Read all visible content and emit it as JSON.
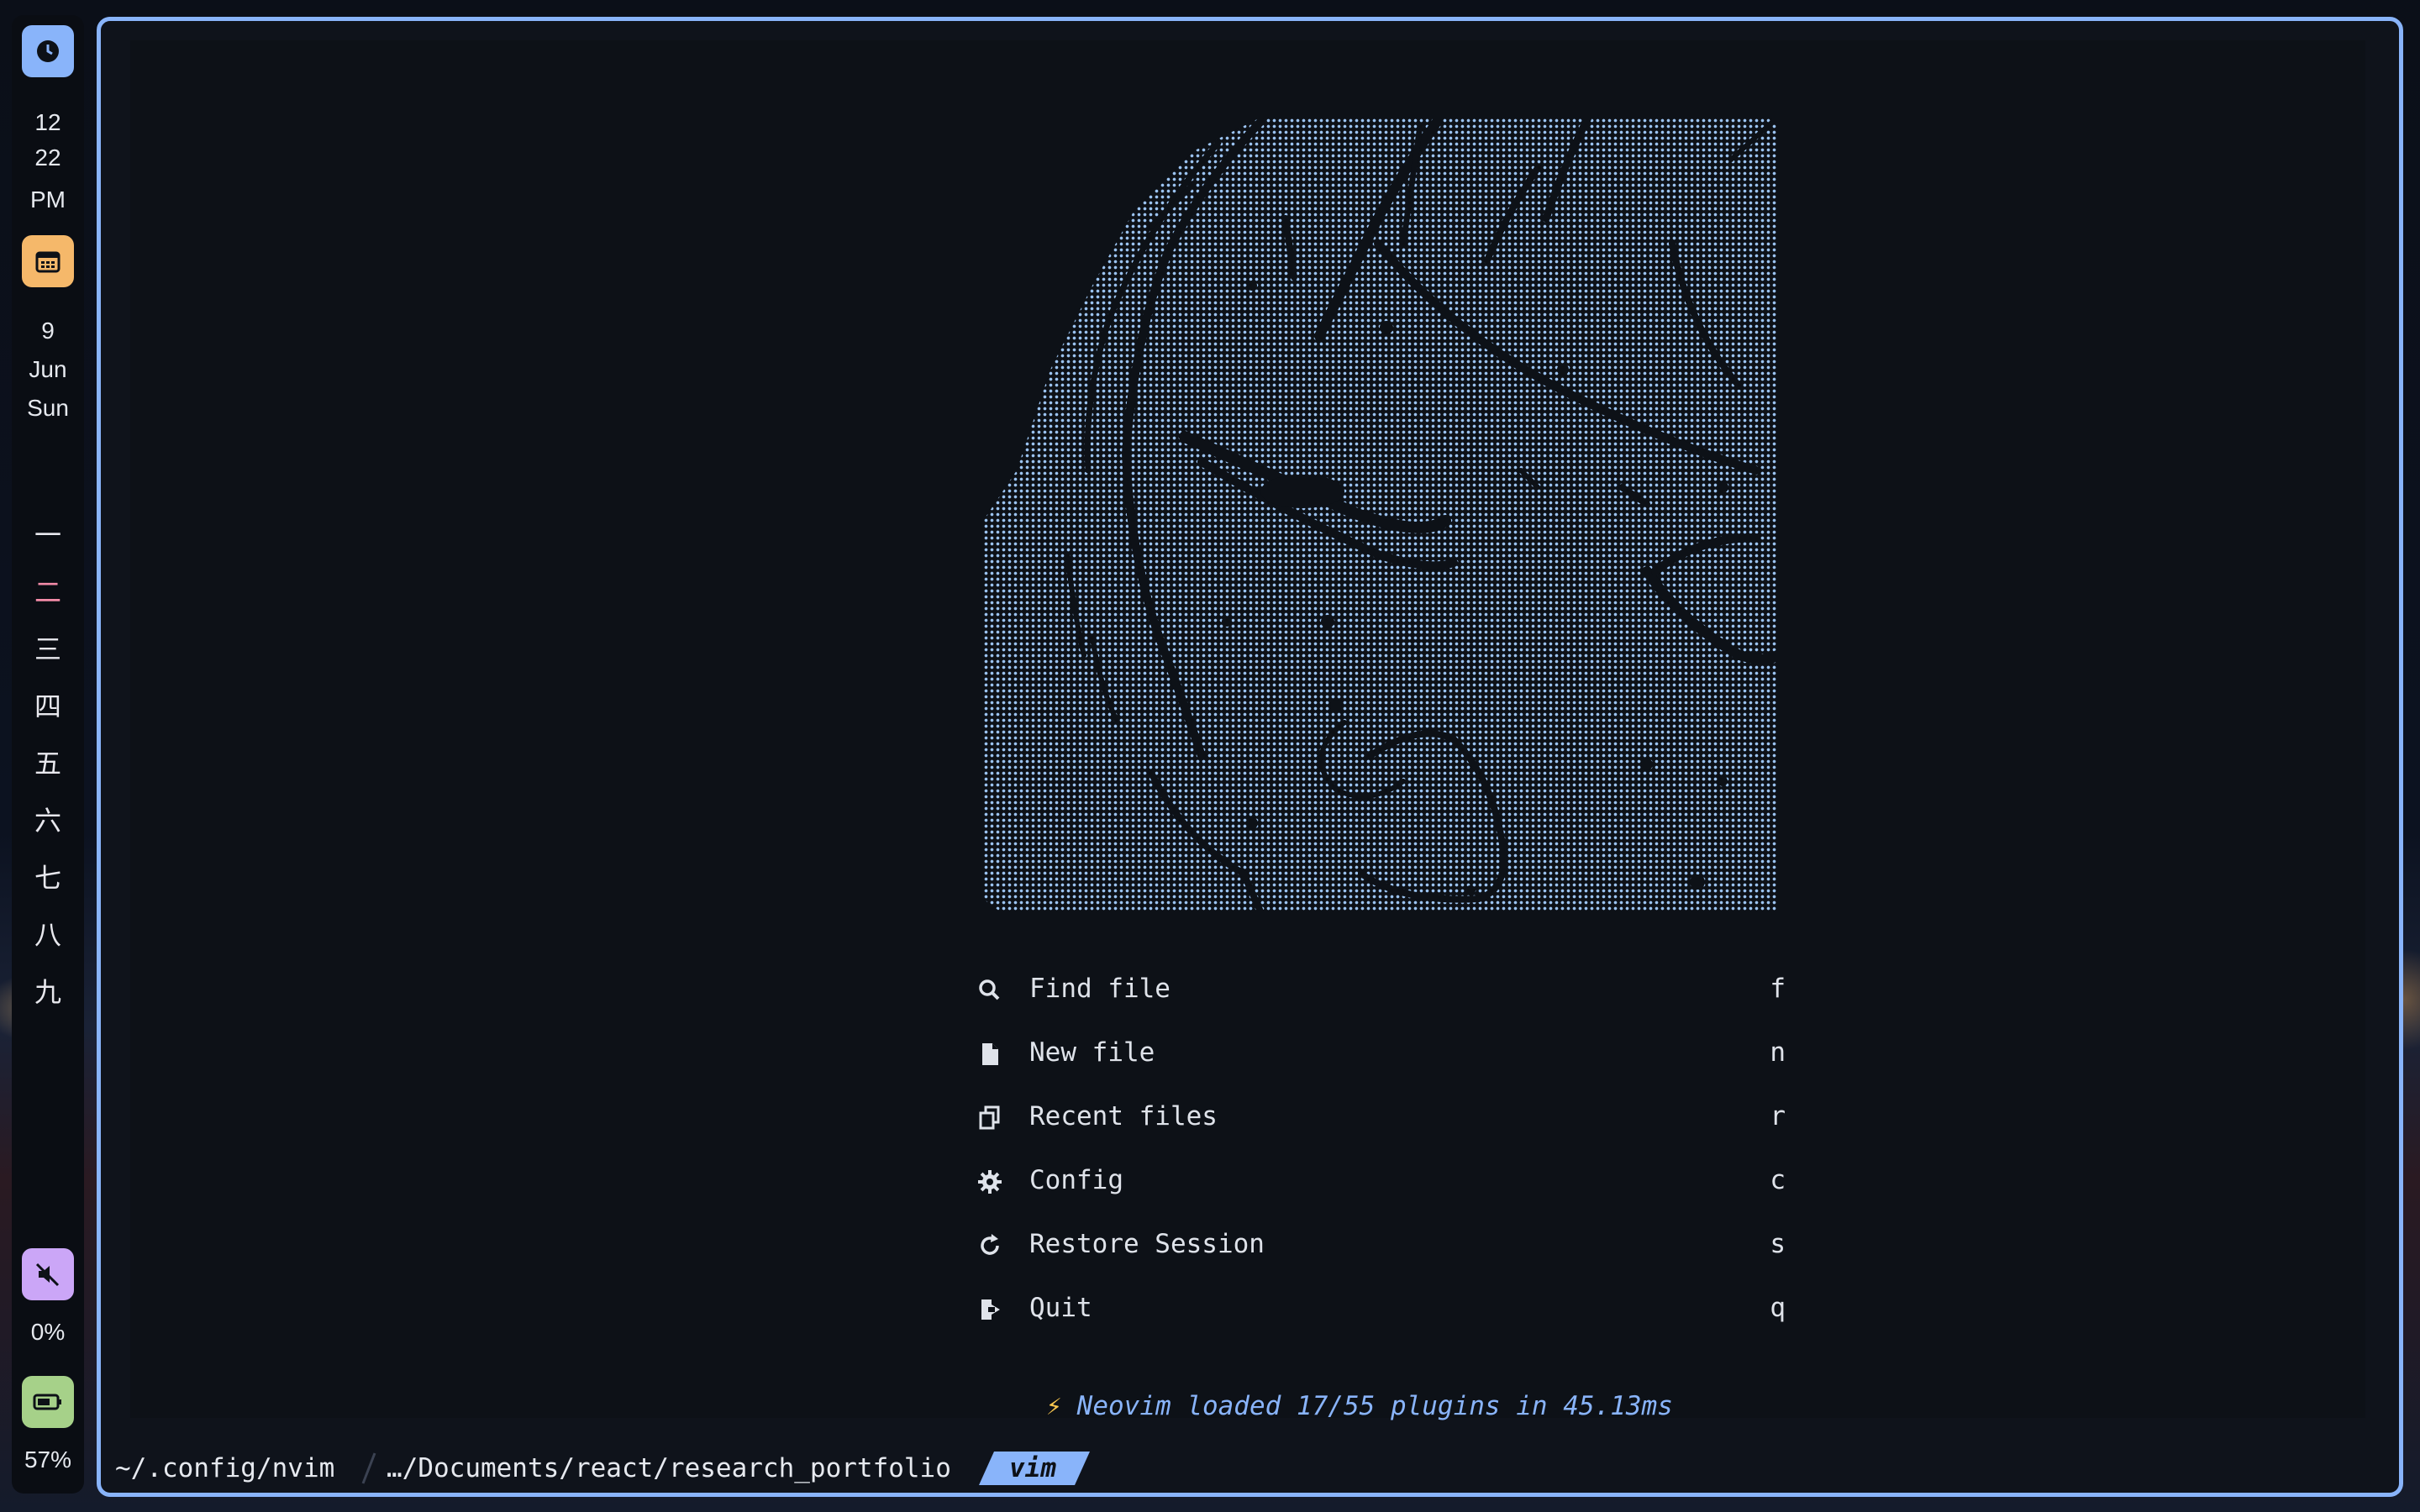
{
  "bar": {
    "clock": {
      "icon": "clock-icon",
      "hour": "12",
      "minute": "22",
      "period": "PM",
      "color": "#89b4fa"
    },
    "date": {
      "icon": "calendar-icon",
      "day": "9",
      "month": "Jun",
      "weekday": "Sun",
      "color": "#f5b86a"
    },
    "workspaces": [
      {
        "label": "一",
        "active": false
      },
      {
        "label": "二",
        "active": true
      },
      {
        "label": "三",
        "active": false
      },
      {
        "label": "四",
        "active": false
      },
      {
        "label": "五",
        "active": false
      },
      {
        "label": "六",
        "active": false
      },
      {
        "label": "七",
        "active": false
      },
      {
        "label": "八",
        "active": false
      },
      {
        "label": "九",
        "active": false
      }
    ],
    "volume": {
      "icon": "muted-speaker-icon",
      "value": "0%",
      "color": "#cba6f7"
    },
    "battery": {
      "icon": "battery-icon",
      "value": "57%",
      "color": "#a6d189"
    }
  },
  "dashboard": {
    "art": {
      "icon": "anime-face-ascii-art",
      "color": "#9cc4f2"
    },
    "menu": [
      {
        "icon": "search-icon",
        "label": "Find file",
        "key": "f"
      },
      {
        "icon": "file-icon",
        "label": "New file",
        "key": "n"
      },
      {
        "icon": "recent-files-icon",
        "label": "Recent files",
        "key": "r"
      },
      {
        "icon": "gear-icon",
        "label": "Config",
        "key": "c"
      },
      {
        "icon": "restore-icon",
        "label": "Restore Session",
        "key": "s"
      },
      {
        "icon": "quit-icon",
        "label": "Quit",
        "key": "q"
      }
    ],
    "footer": {
      "icon": "lightning-icon",
      "text": "Neovim loaded 17/55 plugins in 45.13ms"
    }
  },
  "statusline": {
    "cwd": "~/.config/nvim",
    "path": "…/Documents/react/research_portfolio",
    "mode": "vim"
  }
}
